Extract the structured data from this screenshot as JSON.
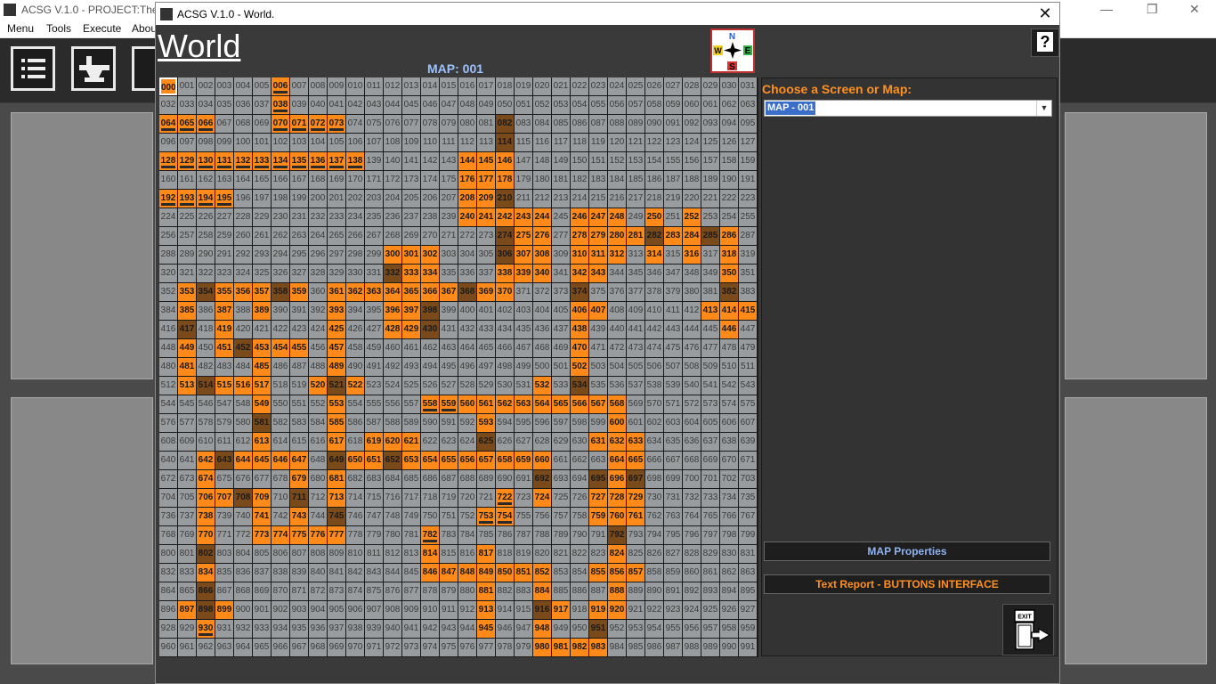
{
  "background_app": {
    "title": "ACSG V.1.0 - PROJECT:The Re",
    "menu": [
      "Menu",
      "Tools",
      "Execute",
      "Abou"
    ]
  },
  "dialog": {
    "title": "ACSG V.1.0 - World.",
    "heading": "World",
    "map_label": "MAP: 001",
    "compass": {
      "n": "N",
      "e": "E",
      "s": "S",
      "w": "W"
    },
    "help_label": "?",
    "choose_label": "Choose a Screen or Map:",
    "selected_map": "MAP - 001",
    "buttons": {
      "map_properties": "MAP Properties",
      "text_report": "Text Report - BUTTONS INTERFACE",
      "exit": "EXIT"
    }
  },
  "colors": {
    "room_open": "#ff8a1a",
    "room_dark": "#7a4a1a",
    "empty": "#989c9e",
    "accent_orange": "#ff9020",
    "accent_blue": "#8fb3ef"
  },
  "grid": {
    "columns": 32,
    "rows": 31,
    "labels_start": 0,
    "label_digits": 3,
    "selected": [
      0
    ],
    "open_rooms": [
      0,
      6,
      38,
      64,
      65,
      66,
      70,
      71,
      72,
      73,
      82,
      114,
      128,
      129,
      130,
      131,
      132,
      133,
      134,
      135,
      136,
      137,
      138,
      144,
      145,
      146,
      176,
      177,
      178,
      208,
      209,
      210,
      240,
      241,
      242,
      243,
      244,
      246,
      247,
      248,
      250,
      252,
      274,
      275,
      276,
      278,
      279,
      280,
      281,
      282,
      283,
      284,
      285,
      286,
      300,
      301,
      302,
      306,
      307,
      308,
      310,
      311,
      312,
      314,
      316,
      318,
      332,
      333,
      334,
      338,
      339,
      340,
      342,
      343,
      350,
      353,
      354,
      355,
      356,
      357,
      358,
      359,
      361,
      362,
      363,
      364,
      365,
      366,
      367,
      368,
      369,
      370,
      374,
      382,
      385,
      387,
      389,
      393,
      396,
      397,
      398,
      406,
      407,
      413,
      414,
      415,
      417,
      419,
      425,
      428,
      429,
      430,
      438,
      446,
      449,
      451,
      452,
      453,
      454,
      455,
      457,
      470,
      481,
      485,
      489,
      502,
      513,
      514,
      515,
      516,
      517,
      520,
      521,
      522,
      532,
      534,
      549,
      553,
      558,
      559,
      560,
      561,
      562,
      563,
      564,
      565,
      566,
      567,
      568,
      581,
      585,
      593,
      600,
      613,
      617,
      619,
      620,
      621,
      625,
      631,
      632,
      633,
      642,
      643,
      644,
      645,
      646,
      647,
      649,
      650,
      651,
      652,
      653,
      654,
      655,
      656,
      657,
      658,
      659,
      660,
      664,
      665,
      674,
      679,
      681,
      692,
      695,
      696,
      697,
      706,
      707,
      708,
      709,
      711,
      713,
      722,
      724,
      727,
      728,
      729,
      738,
      741,
      743,
      745,
      753,
      754,
      759,
      760,
      761,
      770,
      773,
      774,
      775,
      776,
      777,
      782,
      792,
      802,
      814,
      817,
      824,
      834,
      846,
      847,
      848,
      849,
      850,
      851,
      852,
      855,
      856,
      857,
      866,
      881,
      884,
      888,
      897,
      898,
      899,
      913,
      916,
      917,
      919,
      920,
      930,
      945,
      948,
      951,
      980,
      981,
      982,
      983
    ],
    "dark_rooms": [
      82,
      114,
      210,
      274,
      282,
      285,
      306,
      332,
      354,
      358,
      368,
      374,
      382,
      398,
      417,
      430,
      452,
      514,
      521,
      534,
      581,
      625,
      643,
      649,
      652,
      692,
      695,
      697,
      708,
      711,
      745,
      792,
      802,
      866,
      898,
      916,
      951
    ],
    "marked_rooms": [
      6,
      38,
      64,
      65,
      66,
      70,
      71,
      72,
      73,
      128,
      129,
      130,
      131,
      132,
      133,
      134,
      135,
      136,
      137,
      138,
      192,
      193,
      194,
      195,
      558,
      559,
      722,
      753,
      754,
      782,
      930
    ],
    "extra_rooms": [
      192,
      193,
      194,
      195
    ]
  }
}
